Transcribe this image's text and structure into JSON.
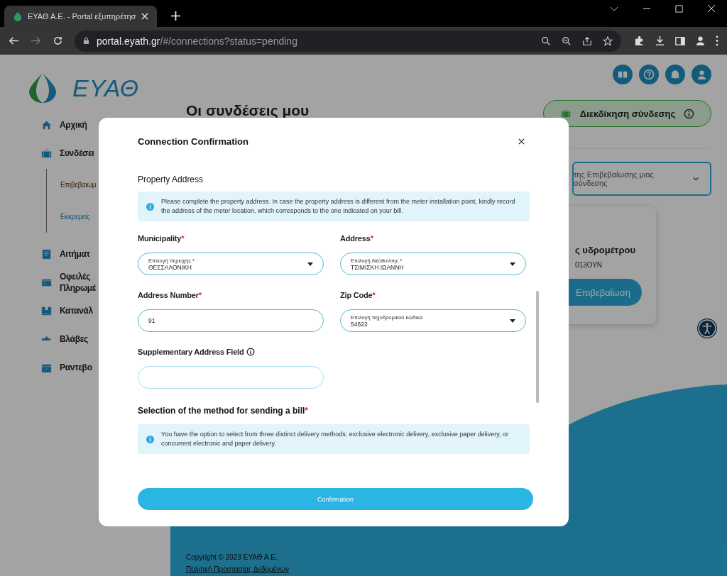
{
  "browser": {
    "tab_title": "ΕΥΑΘ Α.Ε. - Portal εξυπηρέτησ",
    "url_host": "portal.eyath.gr",
    "url_path": "/#/connections?status=pending"
  },
  "logo": {
    "text": "ΕΥΑΘ"
  },
  "sidebar": {
    "items": [
      {
        "label": "Αρχική"
      },
      {
        "label": "Συνδέσει",
        "children": [
          {
            "label": "Επιβεβαιωμ",
            "selected": false
          },
          {
            "label": "Εκκρεμείς",
            "selected": true
          }
        ]
      },
      {
        "label": "Αιτήματ"
      },
      {
        "label": "Οφειλές\nΠληρωμέ"
      },
      {
        "label": "Κατανάλ"
      },
      {
        "label": "Βλάβες"
      },
      {
        "label": "Ραντεβο"
      }
    ]
  },
  "page": {
    "title": "Οι συνδέσεις μου",
    "claim_button": "Διεκδίκηση σύνδεσης",
    "filter_dropdown": "της Επιβεβαίωσης μιας σύνδεσης",
    "card": {
      "title": "ς υδρομέτρου",
      "code": "013ΟΥΝ",
      "button": "Επιβεβαίωση"
    }
  },
  "footer": {
    "copyright": "Copyright © 2023 ΕΥΑΘ Α.Ε.",
    "privacy_link": "Πολιτική Προστασίας Δεδομένων"
  },
  "modal": {
    "title": "Connection Confirmation",
    "section_title": "Property Address",
    "info": "Please complete the property address. In case the property address is different from the meter installation point, kindly record the address of the meter location, which corresponds to the one indicated on your bill.",
    "fields": [
      {
        "label": "Municipality",
        "mark": "*",
        "kind": "select",
        "floating_label": "Επιλογή περιοχής *",
        "value": "ΘΕΣΣΑΛΟΝΙΚΗ"
      },
      {
        "label": "Address",
        "mark": "*",
        "kind": "select",
        "floating_label": "Επιλογή διεύθυνσης *",
        "value": "ΤΣΙΜΙΣΚΗ ΙΩΑΝΝΗ"
      },
      {
        "label": "Address Number",
        "mark": "*",
        "kind": "text",
        "value": "91"
      },
      {
        "label": "Zip Code",
        "mark": "*",
        "kind": "select",
        "floating_label": "Επιλογή ταχυδρομικού κώδικα",
        "value": "54622"
      },
      {
        "label": "Supplementary Address Field",
        "info": true,
        "kind": "text"
      }
    ],
    "delivery": {
      "title": "Selection of the method for sending a bill",
      "mark": "*",
      "info": "You have the option to select from three distinct delivery methods: exclusive electronic delivery, exclusive paper delivery, or concurrent electronic and paper delivery."
    },
    "confirm_button": "Confirmation"
  }
}
